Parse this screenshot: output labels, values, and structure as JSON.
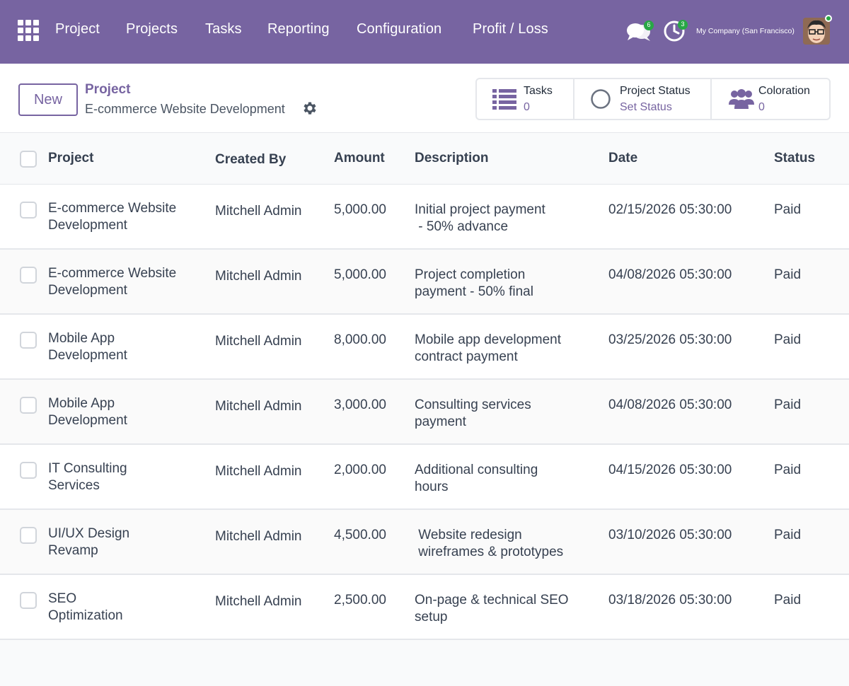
{
  "navbar": {
    "menu": [
      "Project",
      "Projects",
      "Tasks",
      "Reporting",
      "Configuration",
      "Profit / Loss"
    ],
    "messages_badge": "6",
    "activities_badge": "3",
    "company": "My Company (San Francisco)"
  },
  "control_panel": {
    "new_label": "New",
    "breadcrumb_parent": "Project",
    "breadcrumb_current": "E-commerce Website Development",
    "stats": {
      "tasks": {
        "label": "Tasks",
        "value": "0"
      },
      "project_status": {
        "label": "Project Status",
        "value": "Set Status"
      },
      "coloration": {
        "label": "Coloration",
        "value": "0"
      }
    }
  },
  "table": {
    "columns": [
      "Project",
      "Created By",
      "Amount",
      "Description",
      "Date",
      "Status"
    ],
    "rows": [
      {
        "project": [
          "E-commerce Website",
          "Development"
        ],
        "created_by": "Mitchell Admin",
        "amount": "5,000.00",
        "description": [
          "Initial project payment",
          " - 50% advance"
        ],
        "date": "02/15/2026 05:30:00",
        "status": "Paid"
      },
      {
        "project": [
          "E-commerce Website",
          "Development"
        ],
        "created_by": "Mitchell Admin",
        "amount": "5,000.00",
        "description": [
          "Project completion",
          "payment - 50% final"
        ],
        "date": "04/08/2026 05:30:00",
        "status": "Paid"
      },
      {
        "project": [
          "Mobile App",
          "Development"
        ],
        "created_by": "Mitchell Admin",
        "amount": "8,000.00",
        "description": [
          "Mobile app development",
          "contract payment"
        ],
        "date": "03/25/2026 05:30:00",
        "status": "Paid"
      },
      {
        "project": [
          "Mobile App",
          "Development"
        ],
        "created_by": "Mitchell Admin",
        "amount": "3,000.00",
        "description": [
          "Consulting services",
          "payment"
        ],
        "date": "04/08/2026 05:30:00",
        "status": "Paid"
      },
      {
        "project": [
          "IT Consulting",
          "Services"
        ],
        "created_by": "Mitchell Admin",
        "amount": "2,000.00",
        "description": [
          "Additional consulting",
          "hours"
        ],
        "date": "04/15/2026 05:30:00",
        "status": "Paid"
      },
      {
        "project": [
          "UI/UX Design",
          "Revamp"
        ],
        "created_by": "Mitchell Admin",
        "amount": "4,500.00",
        "description": [
          " Website redesign",
          " wireframes & prototypes"
        ],
        "date": "03/10/2026 05:30:00",
        "status": "Paid"
      },
      {
        "project": [
          "SEO",
          "Optimization"
        ],
        "created_by": "Mitchell Admin",
        "amount": "2,500.00",
        "description": [
          "On-page & technical SEO",
          "setup"
        ],
        "date": "03/18/2026 05:30:00",
        "status": "Paid"
      }
    ]
  }
}
